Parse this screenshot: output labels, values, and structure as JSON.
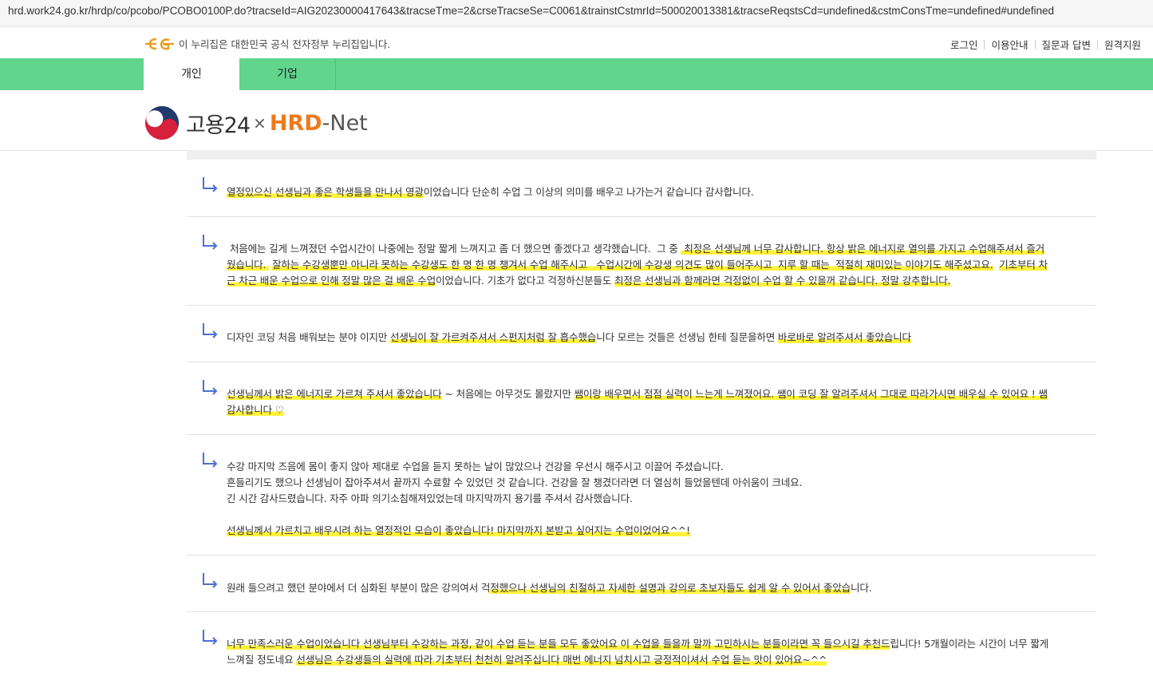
{
  "browser": {
    "url": "hrd.work24.go.kr/hrdp/co/pcobo/PCOBO0100P.do?tracseId=AIG20230000417643&tracseTme=2&crseTracseSe=C0061&trainstCstmrId=500020013381&tracseReqstsCd=undefined&cstmConsTme=undefined#undefined"
  },
  "gov_bar": {
    "notice": "이 누리집은 대한민국 공식 전자정부 누리집입니다.",
    "links": [
      "로그인",
      "이용안내",
      "질문과 답변",
      "원격지원"
    ]
  },
  "nav": {
    "tabs": [
      "개인",
      "기업"
    ],
    "active_tab": "개인"
  },
  "logo": {
    "part1": "고용24",
    "x": "×",
    "part2": "HRD",
    "part3": "-Net"
  },
  "reviews": [
    {
      "lines": [
        [
          [
            "h",
            "열정있으신 선생님과 좋은 학생들을 만나서 영광"
          ],
          [
            "n",
            "이었습니다 단순히 수업 그 이상의 의미를 배우고 나가는거 같습니다 감사합니다."
          ]
        ]
      ]
    },
    {
      "lines": [
        [
          [
            "n",
            " 처음에는 길게 느껴졌던 수업시간이 나중에는 정말 짧게 느껴지고 좀 더 했으면 좋겠다고 생각했습니다.  그 중 "
          ],
          [
            "h",
            " 최정은 선생님께 너무 감사합니다. 항상 밝은 에너지로 열의를 가지고 수업해주셔서 즐거"
          ]
        ],
        [
          [
            "h",
            "웠습니다. "
          ],
          [
            "n",
            " "
          ],
          [
            "h",
            "잘하는 수강생뿐만 아니라 못하는 수강생도 한 명 한 명 챙겨서 수업 해주시고   수업시간에 수강생 의견도 많이 들어주시고  지루 할 때는  적절히 재미있는 이야기도 해주셨고요."
          ],
          [
            "n",
            "  "
          ],
          [
            "h",
            "기초부터 차"
          ]
        ],
        [
          [
            "h",
            "근 차근 배운 수업으로 인해 정말 많은 걸 배운 수업"
          ],
          [
            "n",
            "이었습니다. 기초가 없다고 걱정하신분들도 "
          ],
          [
            "h",
            "최정은 선생님과 함께라면 걱정없이 수업 할 수 있을꺼 같습니다. 정말 강추합니다."
          ]
        ]
      ]
    },
    {
      "lines": [
        [
          [
            "n",
            "디자인 코딩 처음 배워보는 분야 이지만 "
          ],
          [
            "h",
            "선생님이 잘 가르켜주셔서 스펀지처럼 잘 흡수했습"
          ],
          [
            "n",
            "니다 모르는 것들은 선생님 한테 질문을하면 "
          ],
          [
            "h",
            "바로바로 알려주셔서 좋았습니다"
          ]
        ]
      ]
    },
    {
      "lines": [
        [
          [
            "h",
            "선생님께서 밝은 에너지로 가르쳐 주셔서 좋았습니다"
          ],
          [
            "n",
            " ~ 처음에는 아무것도 몰랐지만 "
          ],
          [
            "h",
            "쌤이랑 배우면서 점점 실력이 느는게 느껴졌어요. 쌤이 코딩 잘 알려주셔서 그대로 따라가시면 배우실 수 있어요 ! 쌤"
          ]
        ],
        [
          [
            "h",
            "감사합니다 ♡"
          ]
        ]
      ]
    },
    {
      "lines": [
        [
          [
            "n",
            "수강 마지막 즈음에 몸이 좋지 않아 제대로 수업을 듣지 못하는 날이 많았으나 건강을 우선시 해주시고 이끌어 주셨습니다."
          ]
        ],
        [
          [
            "n",
            "흔들리기도 했으나 선생님이 잡아주셔서 끝까지 수료할 수 있었던 것 같습니다. 건강을 잘 챙겼더라면 더 열심히 들었을텐데 아쉬움이 크네요."
          ]
        ],
        [
          [
            "n",
            "긴 시간 감사드렸습니다. 자주 아파 의기소침해져있었는데 마지막까지 용기를 주셔서 감사했습니다."
          ]
        ],
        [
          [
            "n",
            ""
          ]
        ],
        [
          [
            "h",
            "선생님께서 가르치고 배우시려 하는 열정적인 모습이 좋았습니다! 마지막까지 본받고 싶어지는 수업이었어요^^!"
          ]
        ]
      ]
    },
    {
      "lines": [
        [
          [
            "n",
            "원래 들으려고 했던 분야에서 더 심화된 부분이 많은 강의여서 걱"
          ],
          [
            "h",
            "정했으나 선생님의 친절하고 자세한 설명과 강의로 초보자들도 쉽게 알 수 있어서 좋았습"
          ],
          [
            "n",
            "니다."
          ]
        ]
      ]
    },
    {
      "lines": [
        [
          [
            "h",
            "너무 만족스러운 수업이었습니다 선생님부터 수강하는 과정, 같이 수업 듣는 분들 모두 좋았어요 이 수업을 들을까 말까 고민하시는 분들이라면 꼭 들으시길 추천드"
          ],
          [
            "n",
            "립니다! 5개월이라는 시간이 너무 짧게"
          ]
        ],
        [
          [
            "n",
            "느껴질 정도네요 "
          ],
          [
            "h",
            "선생님은 수강생들의 실력에 따라 기초부터 천천히 알려주십니다 매번 에너지 넘치시고 긍정적이셔서 수업 듣는 맛이 있어요~^^"
          ]
        ]
      ]
    }
  ]
}
